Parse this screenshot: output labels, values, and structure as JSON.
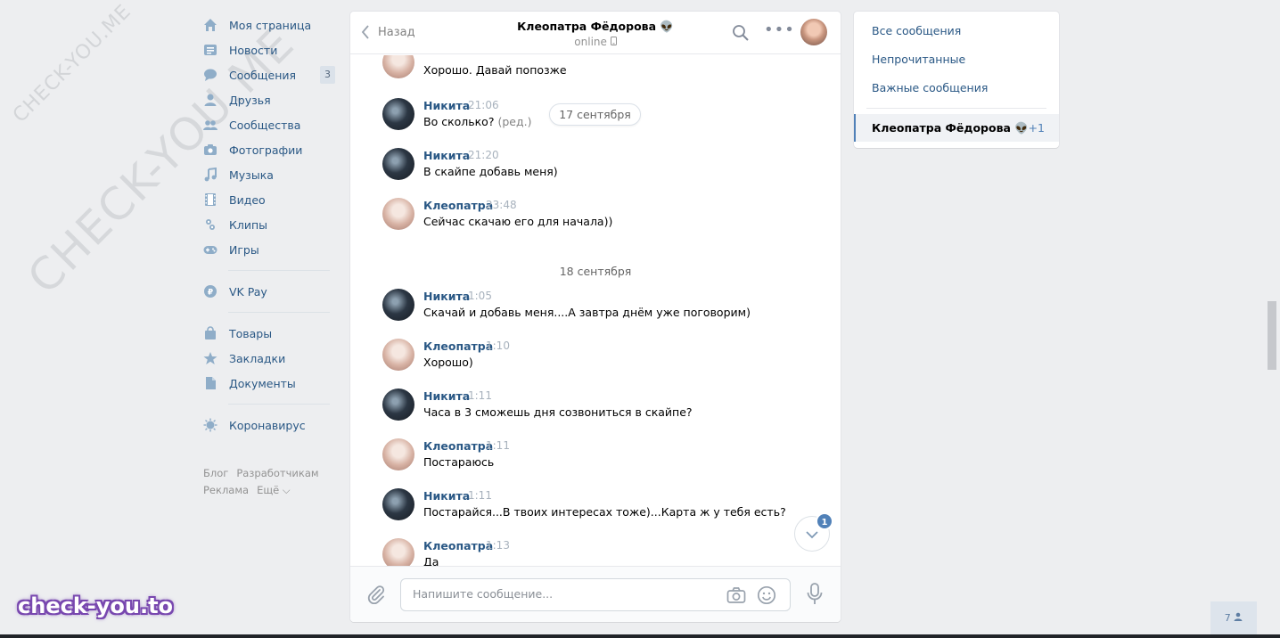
{
  "watermarks": {
    "small": "CHECK-YOU.ME",
    "big": "CHECK-YOU.ME",
    "bottom": "check-you.to"
  },
  "left_menu": {
    "items": [
      {
        "label": "Моя страница",
        "icon": "home-icon"
      },
      {
        "label": "Новости",
        "icon": "news-icon"
      },
      {
        "label": "Сообщения",
        "icon": "messages-icon",
        "badge": "3"
      },
      {
        "label": "Друзья",
        "icon": "friends-icon"
      },
      {
        "label": "Сообщества",
        "icon": "communities-icon"
      },
      {
        "label": "Фотографии",
        "icon": "camera-icon"
      },
      {
        "label": "Музыка",
        "icon": "music-note-icon"
      },
      {
        "label": "Видео",
        "icon": "video-film-icon"
      },
      {
        "label": "Клипы",
        "icon": "clips-icon"
      },
      {
        "label": "Игры",
        "icon": "gamepad-icon"
      }
    ],
    "pay": {
      "label": "VK Pay",
      "icon": "ruble-coin-icon"
    },
    "extra": [
      {
        "label": "Товары",
        "icon": "shopping-bag-icon"
      },
      {
        "label": "Закладки",
        "icon": "star-icon"
      },
      {
        "label": "Документы",
        "icon": "document-icon"
      }
    ],
    "covid": {
      "label": "Коронавирус",
      "icon": "virus-icon"
    },
    "footer": {
      "blog": "Блог",
      "dev": "Разработчикам",
      "ads": "Реклама",
      "more": "Ещё ⌵"
    }
  },
  "chat": {
    "back_label": "Назад",
    "peer_name": "Клеопатра Фёдорова 👽",
    "peer_status": "online",
    "date_pill": "17 сентября",
    "date_sep": "18 сентября",
    "messages": [
      {
        "author": "",
        "time": "",
        "text": "Хорошо. Давай попозже"
      },
      {
        "author": "Никита",
        "time": "21:06",
        "text": "Во сколько?",
        "edited": "(ред.)"
      },
      {
        "author": "Никита",
        "time": "21:20",
        "text": "В скайпе добавь меня)"
      },
      {
        "author": "Клеопатра",
        "time": "23:48",
        "text": "Сейчас скачаю его для начала))"
      },
      {
        "author": "Никита",
        "time": "1:05",
        "text": "Скачай и добавь меня....А завтра днём уже поговорим)"
      },
      {
        "author": "Клеопатра",
        "time": "1:10",
        "text": "Хорошо)"
      },
      {
        "author": "Никита",
        "time": "1:11",
        "text": "Часа в 3 сможешь дня созвониться в скайпе?"
      },
      {
        "author": "Клеопатра",
        "time": "1:11",
        "text": "Постараюсь"
      },
      {
        "author": "Никита",
        "time": "1:11",
        "text": "Постарайся...В твоих интересах тоже)...Карта ж у тебя есть?"
      },
      {
        "author": "Клеопатра",
        "time": "1:13",
        "text": "Да"
      }
    ],
    "unread_badge": "1",
    "composer_placeholder": "Напишите сообщение..."
  },
  "right_panel": {
    "all": "Все сообщения",
    "unread": "Непрочитанные",
    "important": "Важные сообщения",
    "active_dialog": "Клеопатра Фёдорова 👽",
    "active_count": "+1"
  },
  "online_count": "7"
}
